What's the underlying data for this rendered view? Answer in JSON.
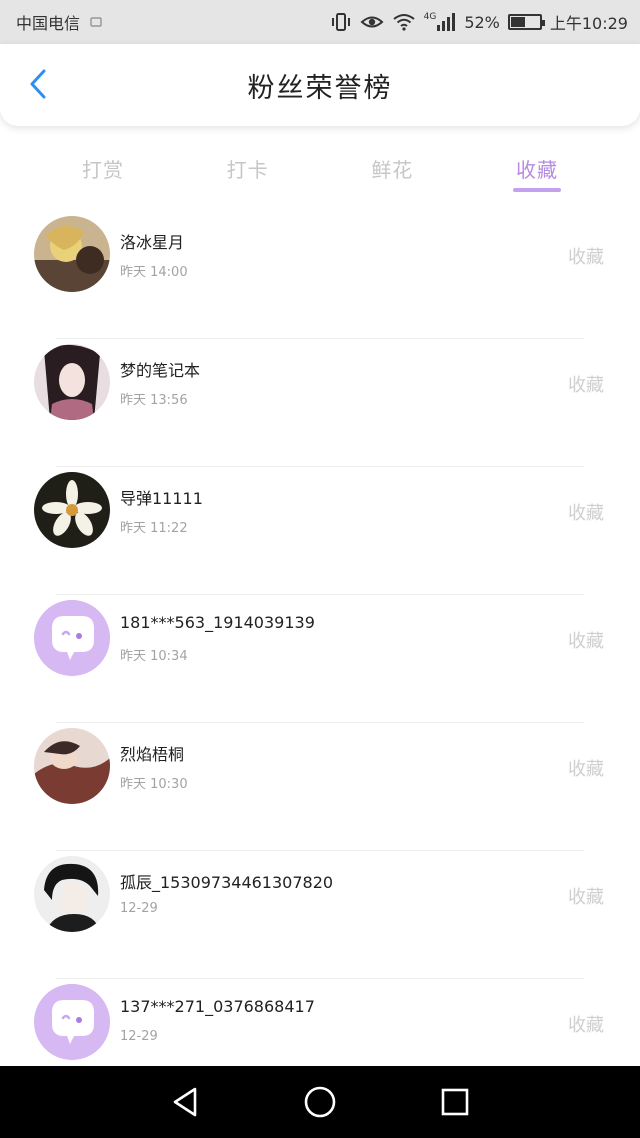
{
  "status_bar": {
    "carrier": "中国电信",
    "network_type": "4G",
    "battery_percent": "52%",
    "battery_level": 0.52,
    "clock": "上午10:29",
    "icons": [
      "vibrate-icon",
      "eye-icon",
      "wifi-icon",
      "signal-icon",
      "battery-icon"
    ]
  },
  "header": {
    "title": "粉丝荣誉榜",
    "back_icon": "chevron-left-icon",
    "accent_color": "#2f8ef2"
  },
  "tabs": [
    {
      "label": "打赏",
      "active": false
    },
    {
      "label": "打卡",
      "active": false
    },
    {
      "label": "鲜花",
      "active": false
    },
    {
      "label": "收藏",
      "active": true
    }
  ],
  "list": {
    "items": [
      {
        "name": "洛冰星月",
        "time": "昨天 14:00",
        "action": "收藏",
        "avatar": "photo-avatar-1"
      },
      {
        "name": "梦的笔记本",
        "time": "昨天 13:56",
        "action": "收藏",
        "avatar": "photo-avatar-2"
      },
      {
        "name": "导弹11111",
        "time": "昨天 11:22",
        "action": "收藏",
        "avatar": "photo-avatar-3"
      },
      {
        "name": "181***563_1914039139",
        "time": "昨天 10:34",
        "action": "收藏",
        "avatar": "default-avatar-icon"
      },
      {
        "name": "烈焰梧桐",
        "time": "昨天 10:30",
        "action": "收藏",
        "avatar": "photo-avatar-4"
      },
      {
        "name": "孤辰_15309734461307820",
        "time": "12-29",
        "action": "收藏",
        "avatar": "photo-avatar-5"
      },
      {
        "name": "137***271_0376868417",
        "time": "12-29",
        "action": "收藏",
        "avatar": "default-avatar-icon"
      }
    ]
  },
  "nav_bar": {
    "buttons": [
      "back-triangle-icon",
      "home-circle-icon",
      "recent-apps-square-icon"
    ]
  },
  "colors": {
    "accent_purple": "#b58be4",
    "avatar_placeholder_bg": "#d6b8f3",
    "inactive_tab": "#c6c6c6",
    "status_bar_bg": "#e5e5e5",
    "nav_bar_bg": "#000000"
  }
}
